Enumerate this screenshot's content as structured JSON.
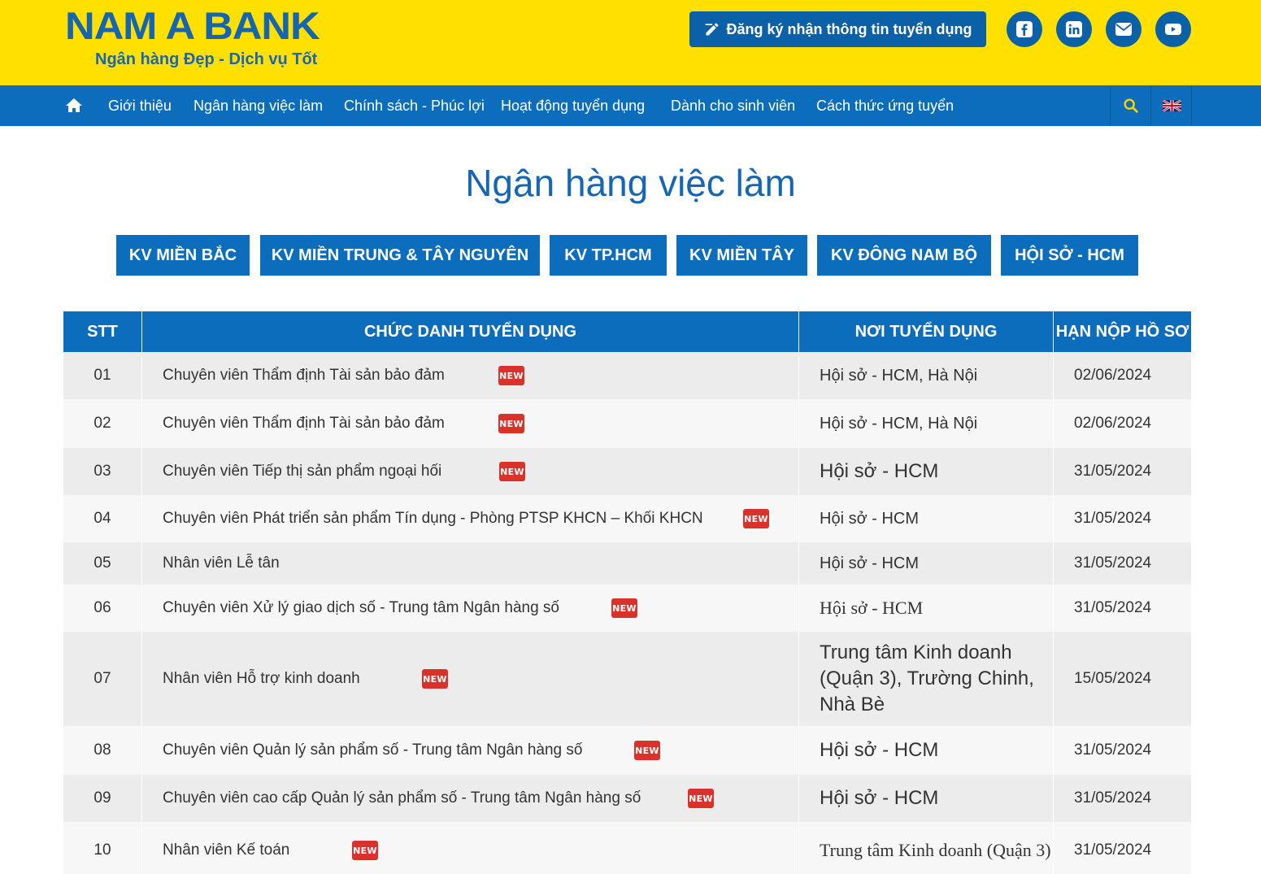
{
  "header": {
    "logo_text": "NAM A BANK",
    "slogan": "Ngân hàng Đẹp - Dịch vụ Tốt",
    "subscribe_label": "Đăng ký nhận thông tin tuyển dụng",
    "social_icons": [
      "facebook-icon",
      "linkedin-icon",
      "email-icon",
      "youtube-icon"
    ]
  },
  "nav": {
    "items": [
      "Giới thiệu",
      "Ngân hàng việc làm",
      "Chính sách - Phúc lợi",
      "Hoạt động tuyển dụng",
      "Dành cho sinh viên",
      "Cách thức ứng tuyển"
    ]
  },
  "page": {
    "title": "Ngân hàng việc làm"
  },
  "regions": [
    "KV MIỀN BẮC",
    "KV MIỀN TRUNG & TÂY NGUYÊN",
    "KV TP.HCM",
    "KV MIỀN TÂY",
    "KV ĐÔNG NAM BỘ",
    "HỘI SỞ - HCM"
  ],
  "table": {
    "headers": [
      "STT",
      "CHỨC DANH TUYỂN DỤNG",
      "NƠI TUYỂN DỤNG",
      "HẠN NỘP HỒ SƠ"
    ],
    "badge_label": "NEW",
    "rows": [
      {
        "stt": "01",
        "title": "Chuyên viên Thẩm định Tài sản bảo đảm",
        "place": "Hội sở - HCM, Hà Nội",
        "deadline": "02/06/2024",
        "is_new": true
      },
      {
        "stt": "02",
        "title": "Chuyên viên Thẩm định Tài sản bảo đảm",
        "place": "Hội sở - HCM, Hà Nội",
        "deadline": "02/06/2024",
        "is_new": true
      },
      {
        "stt": "03",
        "title": "Chuyên viên Tiếp thị sản phẩm ngoại hối",
        "place": "Hội sở - HCM",
        "deadline": "31/05/2024",
        "is_new": true
      },
      {
        "stt": "04",
        "title": "Chuyên viên Phát triển sản phẩm Tín dụng - Phòng PTSP KHCN – Khối KHCN",
        "place": "Hội sở - HCM",
        "deadline": "31/05/2024",
        "is_new": true
      },
      {
        "stt": "05",
        "title": "Nhân viên Lễ tân",
        "place": "Hội sở - HCM",
        "deadline": "31/05/2024",
        "is_new": false
      },
      {
        "stt": "06",
        "title": "Chuyên viên Xử lý giao dịch số - Trung tâm Ngân hàng số",
        "place": "Hội sở - HCM",
        "deadline": "31/05/2024",
        "is_new": true
      },
      {
        "stt": "07",
        "title": "Nhân viên Hỗ trợ kinh doanh",
        "place": "Trung tâm Kinh doanh (Quận 3), Trường Chinh, Nhà Bè",
        "deadline": "15/05/2024",
        "is_new": true
      },
      {
        "stt": "08",
        "title": "Chuyên viên Quản lý sản phẩm số - Trung tâm Ngân hàng số",
        "place": "Hội sở - HCM",
        "deadline": "31/05/2024",
        "is_new": true
      },
      {
        "stt": "09",
        "title": "Chuyên viên cao cấp Quản lý sản phẩm số - Trung tâm Ngân hàng số",
        "place": "Hội sở - HCM",
        "deadline": "31/05/2024",
        "is_new": true
      },
      {
        "stt": "10",
        "title": "Nhân viên Kế toán",
        "place": "Trung tâm Kinh doanh (Quận 3)",
        "deadline": "31/05/2024",
        "is_new": true
      }
    ]
  }
}
